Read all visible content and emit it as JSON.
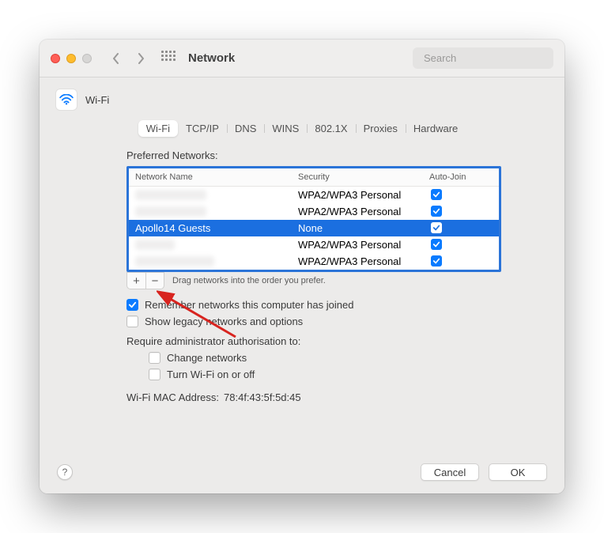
{
  "window": {
    "title": "Network",
    "search_placeholder": "Search"
  },
  "header": {
    "subtitle": "Wi-Fi"
  },
  "tabs": [
    {
      "label": "Wi-Fi",
      "active": true
    },
    {
      "label": "TCP/IP",
      "active": false
    },
    {
      "label": "DNS",
      "active": false
    },
    {
      "label": "WINS",
      "active": false
    },
    {
      "label": "802.1X",
      "active": false
    },
    {
      "label": "Proxies",
      "active": false
    },
    {
      "label": "Hardware",
      "active": false
    }
  ],
  "preferred_networks": {
    "label": "Preferred Networks:",
    "columns": {
      "name": "Network Name",
      "security": "Security",
      "autojoin": "Auto-Join"
    },
    "rows": [
      {
        "name": "",
        "blurred": true,
        "security": "WPA2/WPA3 Personal",
        "autojoin": true,
        "selected": false
      },
      {
        "name": "",
        "blurred": true,
        "security": "WPA2/WPA3 Personal",
        "autojoin": true,
        "selected": false
      },
      {
        "name": "Apollo14 Guests",
        "blurred": false,
        "security": "None",
        "autojoin": true,
        "selected": true
      },
      {
        "name": "",
        "blurred": true,
        "security": "WPA2/WPA3 Personal",
        "autojoin": true,
        "selected": false
      },
      {
        "name": "",
        "blurred": true,
        "security": "WPA2/WPA3 Personal",
        "autojoin": true,
        "selected": false
      }
    ],
    "hint": "Drag networks into the order you prefer.",
    "add_label": "+",
    "remove_label": "−"
  },
  "options": {
    "remember": {
      "label": "Remember networks this computer has joined",
      "checked": true
    },
    "legacy": {
      "label": "Show legacy networks and options",
      "checked": false
    },
    "require_label": "Require administrator authorisation to:",
    "change_networks": {
      "label": "Change networks",
      "checked": false
    },
    "turn_wifi": {
      "label": "Turn Wi-Fi on or off",
      "checked": false
    }
  },
  "mac_address": {
    "label": "Wi-Fi MAC Address:",
    "value": "78:4f:43:5f:5d:45"
  },
  "footer": {
    "help": "?",
    "cancel": "Cancel",
    "ok": "OK"
  }
}
